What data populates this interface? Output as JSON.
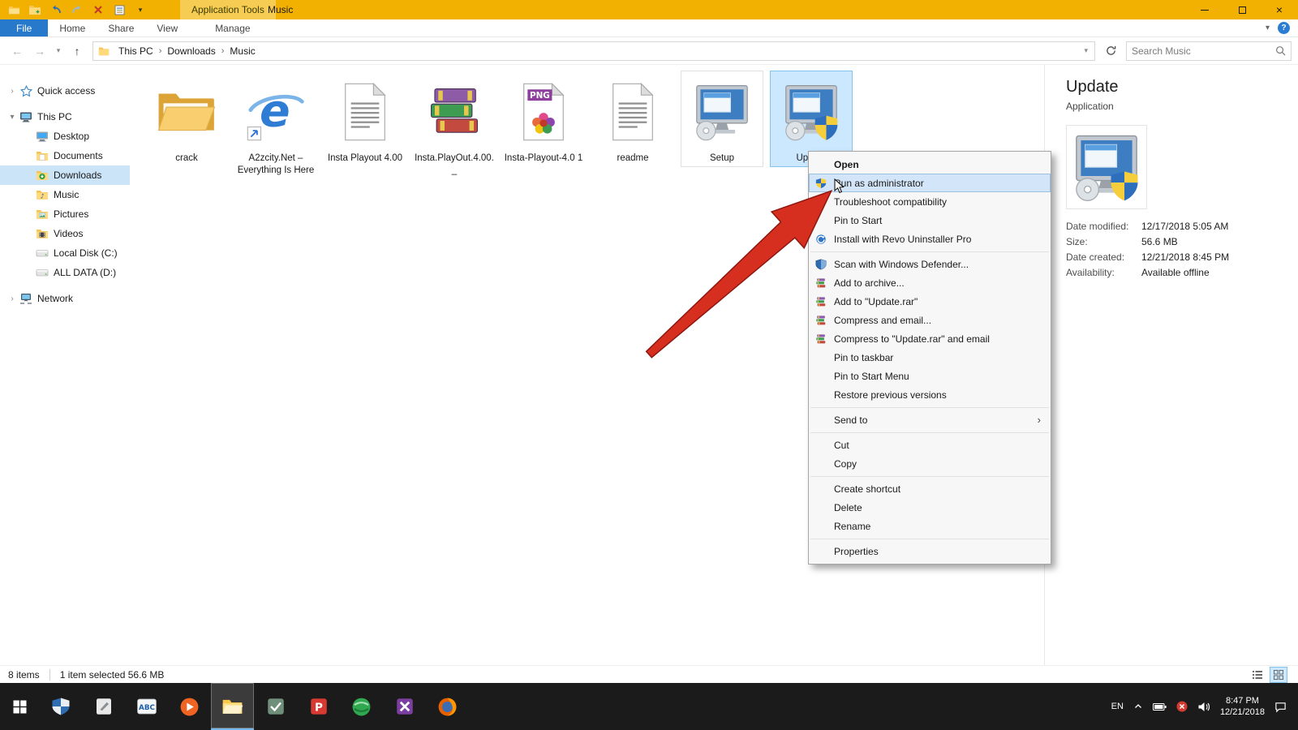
{
  "theme": {
    "titlebar_color": "#F2B100",
    "file_tab_color": "#2779CB",
    "selection_color": "#CCE8FF",
    "taskbar_color": "#1B1B1B"
  },
  "window": {
    "title": "Music",
    "contextual_tab_group": "Application Tools",
    "qat_icons": [
      "explorer",
      "new-folder",
      "undo",
      "redo",
      "delete",
      "properties",
      "qat-dropdown"
    ],
    "controls": [
      "minimize",
      "maximize",
      "close"
    ]
  },
  "ribbon": {
    "tabs": [
      {
        "label": "File",
        "style": "file"
      },
      {
        "label": "Home",
        "style": "normal"
      },
      {
        "label": "Share",
        "style": "normal"
      },
      {
        "label": "View",
        "style": "normal"
      },
      {
        "label": "Manage",
        "style": "contextual"
      }
    ]
  },
  "address_bar": {
    "breadcrumb": [
      "This PC",
      "Downloads",
      "Music"
    ],
    "search_placeholder": "Search Music"
  },
  "sidebar": {
    "items": [
      {
        "label": "Quick access",
        "icon": "star",
        "level": 0,
        "chevron": "collapsed",
        "gap_before": false
      },
      {
        "label": "This PC",
        "icon": "this-pc",
        "level": 0,
        "chevron": "expanded",
        "gap_before": true
      },
      {
        "label": "Desktop",
        "icon": "desktop",
        "level": 1
      },
      {
        "label": "Documents",
        "icon": "documents",
        "level": 1
      },
      {
        "label": "Downloads",
        "icon": "downloads",
        "level": 1,
        "selected": true
      },
      {
        "label": "Music",
        "icon": "music",
        "level": 1
      },
      {
        "label": "Pictures",
        "icon": "pictures",
        "level": 1
      },
      {
        "label": "Videos",
        "icon": "videos",
        "level": 1
      },
      {
        "label": "Local Disk (C:)",
        "icon": "disk",
        "level": 1
      },
      {
        "label": "ALL DATA (D:)",
        "icon": "disk",
        "level": 1
      },
      {
        "label": "Network",
        "icon": "network",
        "level": 0,
        "chevron": "collapsed",
        "gap_before": true
      }
    ]
  },
  "files": [
    {
      "name": "crack",
      "icon": "folder"
    },
    {
      "name": "A2zcity.Net – Everything Is Here",
      "icon": "ie-shortcut"
    },
    {
      "name": "Insta Playout 4.00",
      "icon": "text"
    },
    {
      "name": "Insta.PlayOut.4.00._",
      "icon": "rar"
    },
    {
      "name": "Insta-Playout-4.0 1",
      "icon": "png"
    },
    {
      "name": "readme",
      "icon": "text"
    },
    {
      "name": "Setup",
      "icon": "installer",
      "outlined": true
    },
    {
      "name": "Update",
      "icon": "installer-shield",
      "selected": true
    }
  ],
  "context_menu": {
    "items": [
      {
        "label": "Open",
        "bold": true
      },
      {
        "label": "Run as administrator",
        "icon": "uac-shield",
        "highlighted": true
      },
      {
        "label": "Troubleshoot compatibility"
      },
      {
        "label": "Pin to Start"
      },
      {
        "label": "Install with Revo Uninstaller Pro",
        "icon": "revo"
      },
      {
        "separator": true
      },
      {
        "label": "Scan with Windows Defender...",
        "icon": "defender"
      },
      {
        "label": "Add to archive...",
        "icon": "winrar"
      },
      {
        "label": "Add to \"Update.rar\"",
        "icon": "winrar"
      },
      {
        "label": "Compress and email...",
        "icon": "winrar"
      },
      {
        "label": "Compress to \"Update.rar\" and email",
        "icon": "winrar"
      },
      {
        "label": "Pin to taskbar"
      },
      {
        "label": "Pin to Start Menu"
      },
      {
        "label": "Restore previous versions"
      },
      {
        "separator": true
      },
      {
        "label": "Send to",
        "submenu": true
      },
      {
        "separator": true
      },
      {
        "label": "Cut"
      },
      {
        "label": "Copy"
      },
      {
        "separator": true
      },
      {
        "label": "Create shortcut"
      },
      {
        "label": "Delete"
      },
      {
        "label": "Rename"
      },
      {
        "separator": true
      },
      {
        "label": "Properties"
      }
    ]
  },
  "details_pane": {
    "title": "Update",
    "subtitle": "Application",
    "icon": "installer-shield",
    "properties": [
      {
        "label": "Date modified:",
        "value": "12/17/2018 5:05 AM"
      },
      {
        "label": "Size:",
        "value": "56.6 MB"
      },
      {
        "label": "Date created:",
        "value": "12/21/2018 8:45 PM"
      },
      {
        "label": "Availability:",
        "value": "Available offline"
      }
    ]
  },
  "status_bar": {
    "items_count": "8 items",
    "selection_summary": "1 item selected 56.6 MB",
    "view_buttons": [
      "details-view",
      "large-icons-view"
    ]
  },
  "taskbar": {
    "apps": [
      {
        "name": "windows-defender",
        "icon": "defender-shield"
      },
      {
        "name": "notes-app",
        "icon": "white-app"
      },
      {
        "name": "abc-app",
        "icon": "abc"
      },
      {
        "name": "media-player",
        "icon": "orange-play"
      },
      {
        "name": "file-explorer",
        "icon": "explorer-folder",
        "active": true
      },
      {
        "name": "green-gray-app",
        "icon": "green-gray-app"
      },
      {
        "name": "red-p-app",
        "icon": "red-p"
      },
      {
        "name": "green-orb-app",
        "icon": "green-orb"
      },
      {
        "name": "purple-app",
        "icon": "purple-app"
      },
      {
        "name": "firefox",
        "icon": "firefox"
      }
    ],
    "tray": {
      "language": "EN",
      "time": "8:47 PM",
      "date": "12/21/2018"
    }
  },
  "annotation": {
    "arrow_color": "#D62F1F"
  }
}
